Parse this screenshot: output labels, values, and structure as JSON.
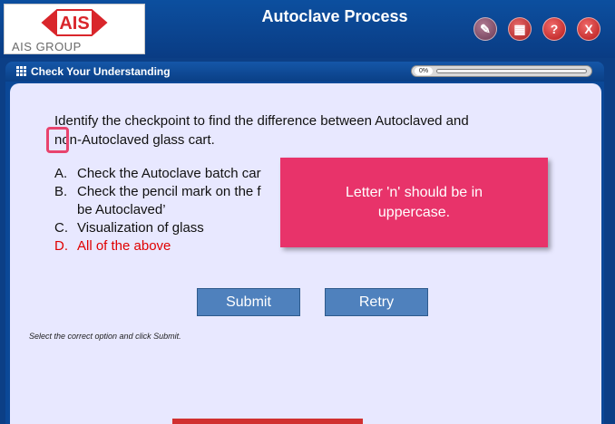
{
  "header": {
    "logo_text": "AIS",
    "logo_sub": "AIS GROUP",
    "title": "Autoclave Process",
    "buttons": [
      {
        "name": "document",
        "glyph": "✎"
      },
      {
        "name": "menu",
        "glyph": "▦"
      },
      {
        "name": "help",
        "glyph": "?"
      },
      {
        "name": "exit",
        "glyph": "X"
      }
    ]
  },
  "panel": {
    "title": "Check Your Understanding",
    "progress_label": "0%",
    "progress_value": 0
  },
  "question": {
    "text_line1": "Identify the checkpoint to find the difference between Autoclaved and",
    "text_line2": "non-Autoclaved glass cart.",
    "options": [
      {
        "letter": "A.",
        "text": "Check the Autoclave batch car"
      },
      {
        "letter": "B.",
        "text": "Check the pencil mark on the f"
      },
      {
        "letter": "",
        "text": "be Autoclaved’"
      },
      {
        "letter": "C.",
        "text": "Visualization of glass"
      },
      {
        "letter": "D.",
        "text": "All of the above"
      }
    ]
  },
  "actions": {
    "submit_label": "Submit",
    "retry_label": "Retry",
    "instruction": "Select the correct option and click Submit."
  },
  "annotation": {
    "comment": "Letter 'n' should be in uppercase."
  },
  "colors": {
    "header_bg": "#0b4897",
    "content_bg": "#e8e8ff",
    "button_bg": "#4f81bd",
    "highlight_option": "#e00000",
    "comment_bg": "#e8336a"
  }
}
